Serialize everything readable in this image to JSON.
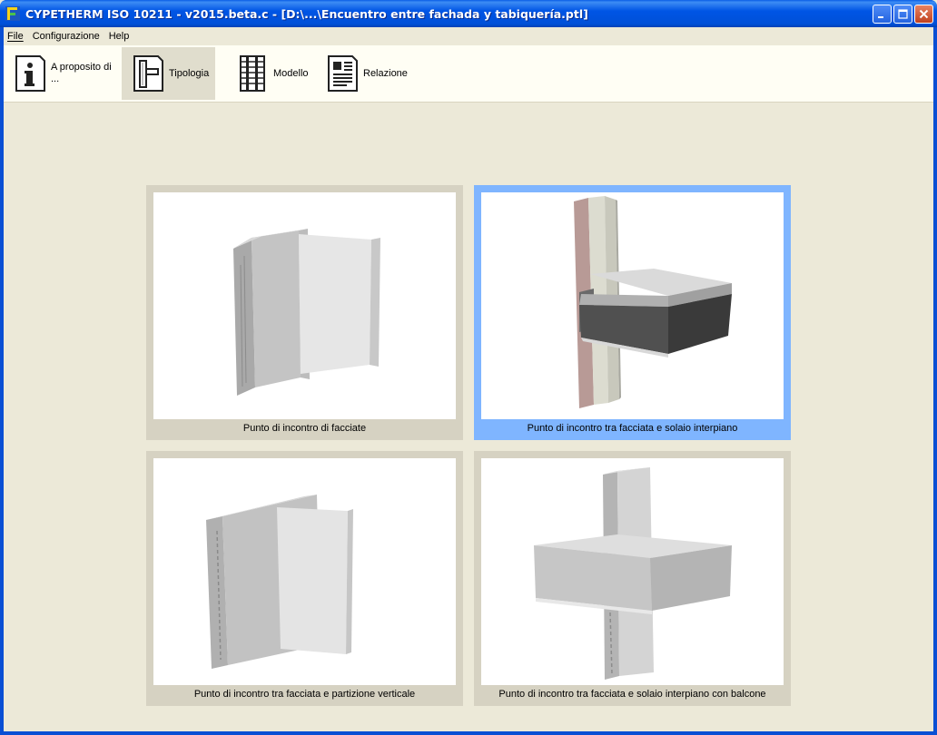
{
  "window": {
    "title": "CYPETHERM ISO 10211 - v2015.beta.c - [D:\\...\\Encuentro entre fachada y tabiquería.ptl]"
  },
  "menu": {
    "file": "File",
    "configurazione": "Configurazione",
    "help": "Help"
  },
  "toolbar": {
    "about_line1": "A proposito di",
    "about_line2": "...",
    "tipologia": "Tipologia",
    "modello": "Modello",
    "relazione": "Relazione",
    "active": "Tipologia"
  },
  "cards": [
    {
      "caption": "Punto di incontro di facciate",
      "selected": false
    },
    {
      "caption": "Punto di incontro tra facciata e solaio interpiano",
      "selected": true
    },
    {
      "caption": "Punto di incontro tra facciata e partizione verticale",
      "selected": false
    },
    {
      "caption": "Punto di incontro tra facciata e solaio interpiano con balcone",
      "selected": false
    }
  ],
  "colors": {
    "selection": "#7fb5ff",
    "card_bg": "#d6d2c2",
    "window_bg": "#ece9d8",
    "titlebar": "#0055e5"
  }
}
